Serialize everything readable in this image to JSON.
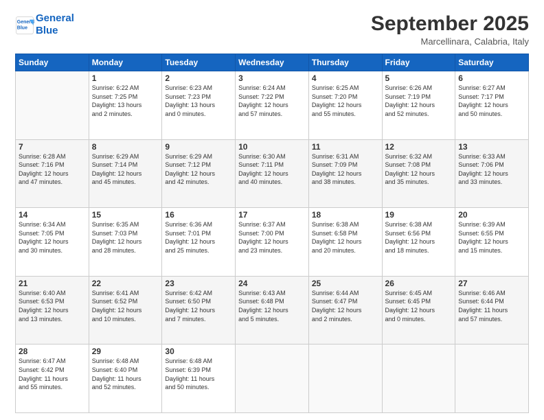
{
  "logo": {
    "line1": "General",
    "line2": "Blue"
  },
  "title": "September 2025",
  "subtitle": "Marcellinara, Calabria, Italy",
  "weekdays": [
    "Sunday",
    "Monday",
    "Tuesday",
    "Wednesday",
    "Thursday",
    "Friday",
    "Saturday"
  ],
  "weeks": [
    [
      {
        "day": "",
        "info": ""
      },
      {
        "day": "1",
        "info": "Sunrise: 6:22 AM\nSunset: 7:25 PM\nDaylight: 13 hours\nand 2 minutes."
      },
      {
        "day": "2",
        "info": "Sunrise: 6:23 AM\nSunset: 7:23 PM\nDaylight: 13 hours\nand 0 minutes."
      },
      {
        "day": "3",
        "info": "Sunrise: 6:24 AM\nSunset: 7:22 PM\nDaylight: 12 hours\nand 57 minutes."
      },
      {
        "day": "4",
        "info": "Sunrise: 6:25 AM\nSunset: 7:20 PM\nDaylight: 12 hours\nand 55 minutes."
      },
      {
        "day": "5",
        "info": "Sunrise: 6:26 AM\nSunset: 7:19 PM\nDaylight: 12 hours\nand 52 minutes."
      },
      {
        "day": "6",
        "info": "Sunrise: 6:27 AM\nSunset: 7:17 PM\nDaylight: 12 hours\nand 50 minutes."
      }
    ],
    [
      {
        "day": "7",
        "info": "Sunrise: 6:28 AM\nSunset: 7:16 PM\nDaylight: 12 hours\nand 47 minutes."
      },
      {
        "day": "8",
        "info": "Sunrise: 6:29 AM\nSunset: 7:14 PM\nDaylight: 12 hours\nand 45 minutes."
      },
      {
        "day": "9",
        "info": "Sunrise: 6:29 AM\nSunset: 7:12 PM\nDaylight: 12 hours\nand 42 minutes."
      },
      {
        "day": "10",
        "info": "Sunrise: 6:30 AM\nSunset: 7:11 PM\nDaylight: 12 hours\nand 40 minutes."
      },
      {
        "day": "11",
        "info": "Sunrise: 6:31 AM\nSunset: 7:09 PM\nDaylight: 12 hours\nand 38 minutes."
      },
      {
        "day": "12",
        "info": "Sunrise: 6:32 AM\nSunset: 7:08 PM\nDaylight: 12 hours\nand 35 minutes."
      },
      {
        "day": "13",
        "info": "Sunrise: 6:33 AM\nSunset: 7:06 PM\nDaylight: 12 hours\nand 33 minutes."
      }
    ],
    [
      {
        "day": "14",
        "info": "Sunrise: 6:34 AM\nSunset: 7:05 PM\nDaylight: 12 hours\nand 30 minutes."
      },
      {
        "day": "15",
        "info": "Sunrise: 6:35 AM\nSunset: 7:03 PM\nDaylight: 12 hours\nand 28 minutes."
      },
      {
        "day": "16",
        "info": "Sunrise: 6:36 AM\nSunset: 7:01 PM\nDaylight: 12 hours\nand 25 minutes."
      },
      {
        "day": "17",
        "info": "Sunrise: 6:37 AM\nSunset: 7:00 PM\nDaylight: 12 hours\nand 23 minutes."
      },
      {
        "day": "18",
        "info": "Sunrise: 6:38 AM\nSunset: 6:58 PM\nDaylight: 12 hours\nand 20 minutes."
      },
      {
        "day": "19",
        "info": "Sunrise: 6:38 AM\nSunset: 6:56 PM\nDaylight: 12 hours\nand 18 minutes."
      },
      {
        "day": "20",
        "info": "Sunrise: 6:39 AM\nSunset: 6:55 PM\nDaylight: 12 hours\nand 15 minutes."
      }
    ],
    [
      {
        "day": "21",
        "info": "Sunrise: 6:40 AM\nSunset: 6:53 PM\nDaylight: 12 hours\nand 13 minutes."
      },
      {
        "day": "22",
        "info": "Sunrise: 6:41 AM\nSunset: 6:52 PM\nDaylight: 12 hours\nand 10 minutes."
      },
      {
        "day": "23",
        "info": "Sunrise: 6:42 AM\nSunset: 6:50 PM\nDaylight: 12 hours\nand 7 minutes."
      },
      {
        "day": "24",
        "info": "Sunrise: 6:43 AM\nSunset: 6:48 PM\nDaylight: 12 hours\nand 5 minutes."
      },
      {
        "day": "25",
        "info": "Sunrise: 6:44 AM\nSunset: 6:47 PM\nDaylight: 12 hours\nand 2 minutes."
      },
      {
        "day": "26",
        "info": "Sunrise: 6:45 AM\nSunset: 6:45 PM\nDaylight: 12 hours\nand 0 minutes."
      },
      {
        "day": "27",
        "info": "Sunrise: 6:46 AM\nSunset: 6:44 PM\nDaylight: 11 hours\nand 57 minutes."
      }
    ],
    [
      {
        "day": "28",
        "info": "Sunrise: 6:47 AM\nSunset: 6:42 PM\nDaylight: 11 hours\nand 55 minutes."
      },
      {
        "day": "29",
        "info": "Sunrise: 6:48 AM\nSunset: 6:40 PM\nDaylight: 11 hours\nand 52 minutes."
      },
      {
        "day": "30",
        "info": "Sunrise: 6:48 AM\nSunset: 6:39 PM\nDaylight: 11 hours\nand 50 minutes."
      },
      {
        "day": "",
        "info": ""
      },
      {
        "day": "",
        "info": ""
      },
      {
        "day": "",
        "info": ""
      },
      {
        "day": "",
        "info": ""
      }
    ]
  ]
}
